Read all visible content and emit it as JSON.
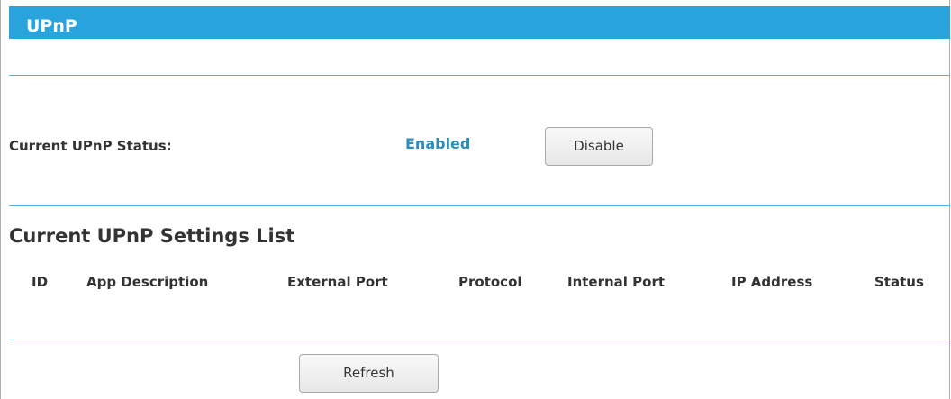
{
  "page": {
    "title": "UPnP"
  },
  "status": {
    "label": "Current UPnP Status:",
    "value": "Enabled",
    "toggle_button": "Disable"
  },
  "settings_list": {
    "title": "Current UPnP Settings List",
    "columns": [
      "ID",
      "App Description",
      "External Port",
      "Protocol",
      "Internal Port",
      "IP Address",
      "Status"
    ],
    "rows": []
  },
  "actions": {
    "refresh_button": "Refresh"
  },
  "colors": {
    "title_bar": "#29a3dc",
    "status_value": "#2a8fbd",
    "divider": "#4fb7e6"
  }
}
